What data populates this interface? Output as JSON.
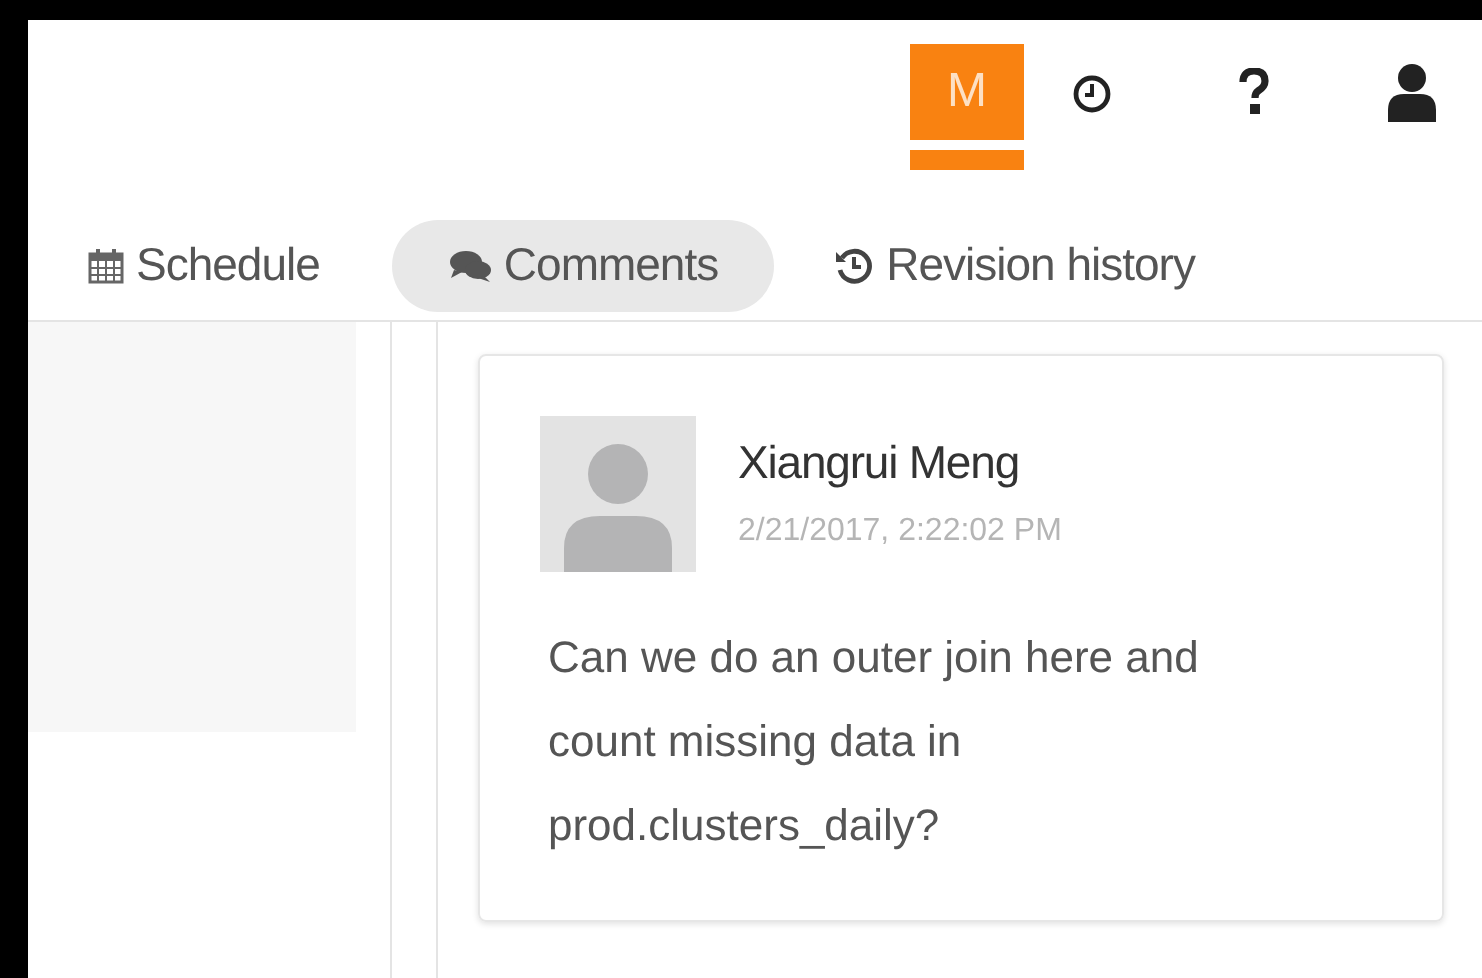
{
  "header": {
    "user_initial": "M"
  },
  "tabs": [
    {
      "label": "Schedule",
      "kind": "calendar",
      "selected": false
    },
    {
      "label": "Comments",
      "kind": "chat",
      "selected": true
    },
    {
      "label": "Revision history",
      "kind": "history",
      "selected": false
    }
  ],
  "comments": [
    {
      "author": "Xiangrui Meng",
      "time": "2/21/2017, 2:22:02 PM",
      "text": "Can we do an outer join here and count missing data in prod.clusters_daily?"
    }
  ]
}
